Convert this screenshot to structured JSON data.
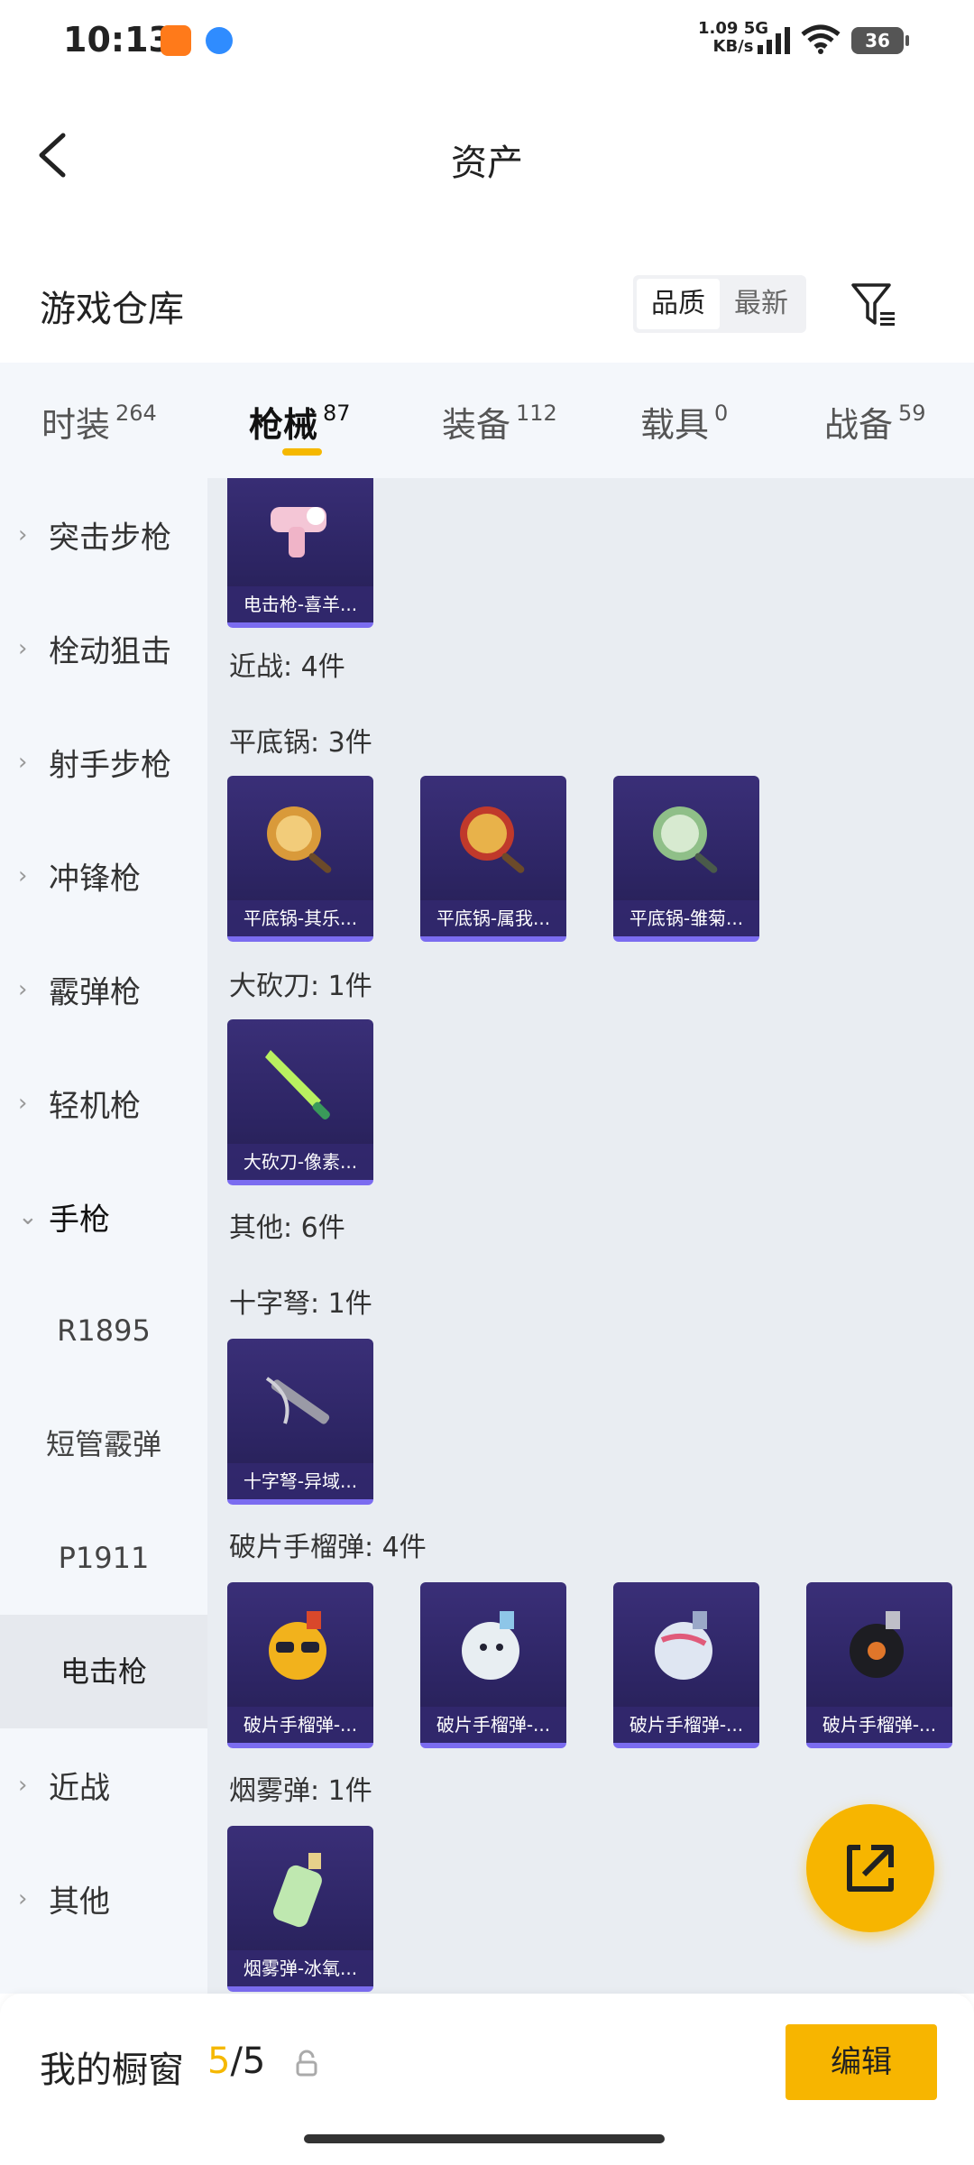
{
  "status_bar": {
    "time": "10:13",
    "speed_value": "1.09",
    "speed_unit": "KB/s",
    "network": "5G",
    "battery": "36"
  },
  "header": {
    "title": "资产"
  },
  "warehouse": {
    "title": "游戏仓库",
    "sort_options": [
      "品质",
      "最新"
    ],
    "active_sort": "品质"
  },
  "tabs": [
    {
      "label": "时装",
      "count": "264"
    },
    {
      "label": "枪械",
      "count": "87"
    },
    {
      "label": "装备",
      "count": "112"
    },
    {
      "label": "载具",
      "count": "0"
    },
    {
      "label": "战备",
      "count": "59"
    }
  ],
  "sidebar": {
    "items": [
      "突击步枪",
      "栓动狙击",
      "射手步枪",
      "冲锋枪",
      "霰弹枪",
      "轻机枪",
      "手枪"
    ],
    "sub_items": [
      "R1895",
      "短管霰弹",
      "P1911",
      "电击枪"
    ],
    "items_after": [
      "近战",
      "其他"
    ]
  },
  "content": {
    "sections": [
      {
        "label": "近战: 4件"
      },
      {
        "label": "平底锅: 3件"
      },
      {
        "label": "大砍刀: 1件"
      },
      {
        "label": "其他: 6件"
      },
      {
        "label": "十字弩: 1件"
      },
      {
        "label": "破片手榴弹: 4件"
      },
      {
        "label": "烟雾弹: 1件"
      }
    ],
    "cards": {
      "stun_gun": "电击枪-喜羊...",
      "pan1": "平底锅-其乐...",
      "pan2": "平底锅-属我...",
      "pan3": "平底锅-雏菊...",
      "machete": "大砍刀-像素...",
      "crossbow": "十字弩-异域...",
      "grenade1": "破片手榴弹-...",
      "grenade2": "破片手榴弹-...",
      "grenade3": "破片手榴弹-...",
      "grenade4": "破片手榴弹-...",
      "smoke": "烟雾弹-冰氧..."
    }
  },
  "bottom_bar": {
    "title": "我的橱窗",
    "count_current": "5",
    "count_total": "/5",
    "edit_label": "编辑"
  },
  "colors": {
    "accent": "#f7b500",
    "card_bg": "#2d2564",
    "sidebar_bg": "#f4f7fb",
    "content_bg": "#e9edf2"
  }
}
